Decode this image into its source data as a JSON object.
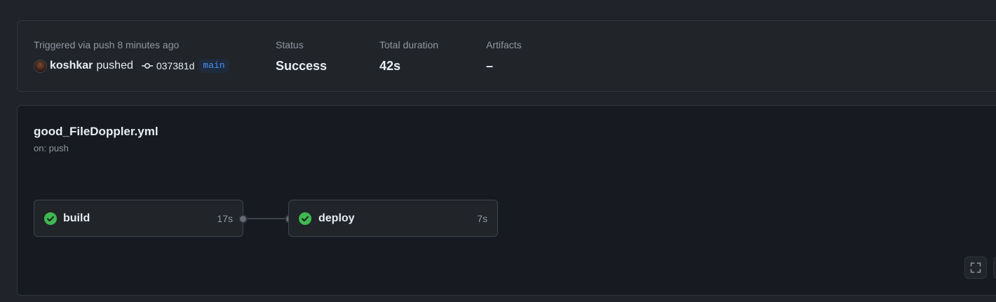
{
  "run_summary": {
    "trigger": {
      "label": "Triggered via push 8 minutes ago",
      "actor": "koshkar",
      "action": "pushed",
      "commit_sha": "037381d",
      "branch": "main"
    },
    "status": {
      "label": "Status",
      "value": "Success"
    },
    "duration": {
      "label": "Total duration",
      "value": "42s"
    },
    "artifacts": {
      "label": "Artifacts",
      "value": "–"
    }
  },
  "workflow": {
    "file_name": "good_FileDoppler.yml",
    "event": "on: push",
    "jobs": [
      {
        "name": "build",
        "duration": "17s",
        "status": "success",
        "status_icon": "check-circle-icon"
      },
      {
        "name": "deploy",
        "duration": "7s",
        "status": "success",
        "status_icon": "check-circle-icon"
      }
    ],
    "controls": {
      "fullscreen_icon": "fullscreen-icon"
    }
  },
  "colors": {
    "page_bg": "#202329",
    "card_bg": "#171a20",
    "success": "#3fb950",
    "branch_blue": "#4493f8",
    "muted_text": "#9198a1"
  }
}
